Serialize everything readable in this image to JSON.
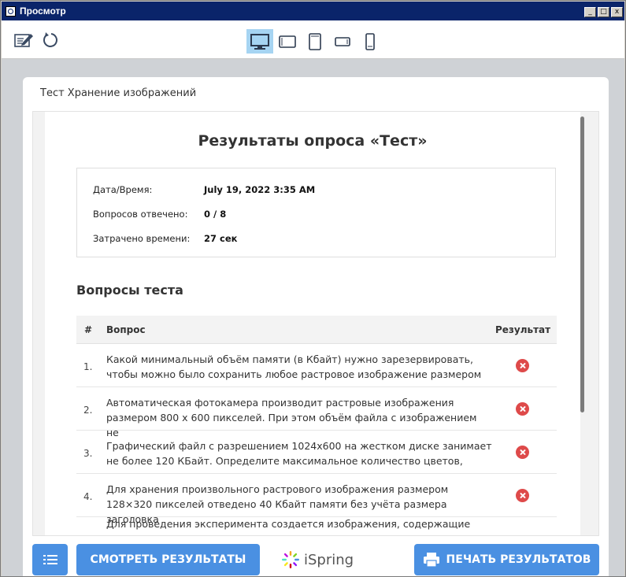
{
  "window": {
    "title": "Просмотр",
    "controls": [
      "_",
      "□",
      "x"
    ]
  },
  "toolbar": {
    "tools": [
      "edit-icon",
      "refresh-icon"
    ],
    "devices": [
      {
        "name": "desktop",
        "active": true
      },
      {
        "name": "tablet-landscape",
        "active": false
      },
      {
        "name": "tablet-portrait",
        "active": false
      },
      {
        "name": "phone-landscape",
        "active": false
      },
      {
        "name": "phone-portrait",
        "active": false
      }
    ]
  },
  "card": {
    "title": "Тест Хранение изображений"
  },
  "results": {
    "title": "Результаты опроса «Тест»",
    "info": [
      {
        "label": "Дата/Время:",
        "value": "July 19, 2022 3:35 AM"
      },
      {
        "label": "Вопросов отвечено:",
        "value": "0 / 8"
      },
      {
        "label": "Затрачено времени:",
        "value": "27 сек"
      }
    ]
  },
  "questions": {
    "heading": "Вопросы теста",
    "columns": {
      "num": "#",
      "question": "Вопрос",
      "result": "Результат"
    },
    "rows": [
      {
        "num": "1.",
        "text": "Какой минимальный объём памяти (в Кбайт) нужно зарезервировать,\nчтобы можно было сохранить любое растровое изображение размером",
        "result": "incorrect"
      },
      {
        "num": "2.",
        "text": "Автоматическая фотокамера производит растровые изображения\nразмером 800 x 600 пикселей. При этом объём файла с изображением не",
        "result": "incorrect"
      },
      {
        "num": "3.",
        "text": "Графический файл с разрешением 1024x600 на жестком диске занимает\nне более 120 КБайт. Определите максимальное количество цветов,",
        "result": "incorrect"
      },
      {
        "num": "4.",
        "text": "Для хранения произвольного растрового изображения размером\n128×320 пикселей отведено 40 Кбайт памяти без учёта размера заголовка",
        "result": "incorrect"
      }
    ],
    "partial_row": "Для проведения эксперимента создается изображения, содержащие"
  },
  "footer": {
    "view_results": "СМОТРЕТЬ РЕЗУЛЬТАТЫ",
    "brand": "iSpring",
    "print_results": "ПЕЧАТЬ РЕЗУЛЬТАТОВ"
  },
  "colors": {
    "accent": "#4a90e2",
    "error": "#de4a4a",
    "titlebar": "#0a246a",
    "active_device": "#a6d4f2"
  }
}
